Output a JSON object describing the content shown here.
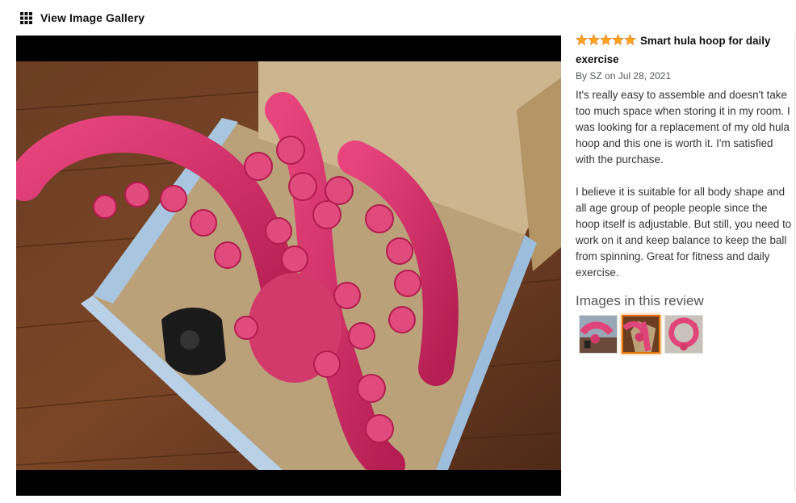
{
  "gallery": {
    "label": "View Image Gallery",
    "icon": "grid-icon"
  },
  "viewer": {
    "image_label": "hula hoop pieces in box"
  },
  "review": {
    "rating": 5,
    "max_rating": 5,
    "star_color": "#ffa41c",
    "title": "Smart hula hoop for daily exercise",
    "by_prefix": "By",
    "author": "SZ",
    "on_prefix": "on",
    "date": "Jul 28, 2021",
    "paragraphs": [
      "It's really easy to assemble and doesn't take too much space when storing it in my room. I was looking for a replacement of my old hula hoop and this one is worth it. I'm satisfied with the purchase.",
      "I believe it is suitable for all body shape and all age group of people people since the hoop itself is adjustable. But still, you need to work on it and keep balance to keep the ball from spinning. Great for fitness and daily exercise."
    ],
    "images_heading": "Images in this review",
    "thumbnails": [
      "thumbnail-1",
      "thumbnail-2",
      "thumbnail-3"
    ],
    "selected_thumbnail": 2,
    "accent_color": "#e77600"
  }
}
